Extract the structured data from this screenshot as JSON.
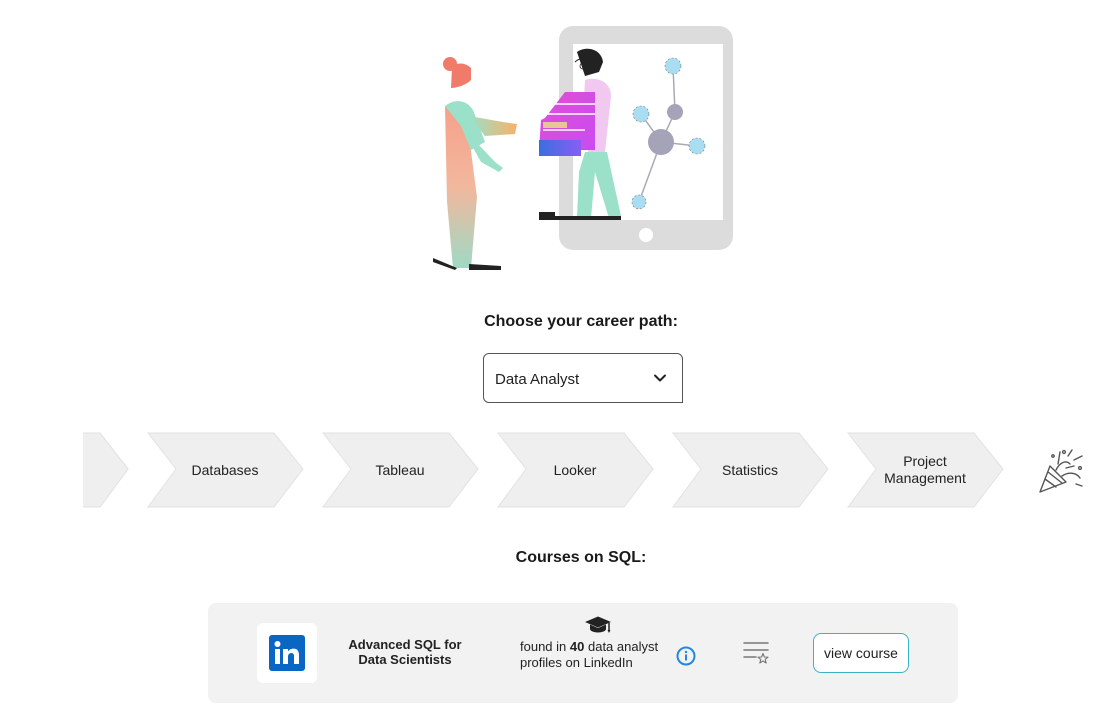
{
  "career": {
    "title": "Choose your career path:",
    "selected": "Data Analyst"
  },
  "steps": [
    "Databases",
    "Tableau",
    "Looker",
    "Statistics",
    "Project Management"
  ],
  "end_icon": "party-popper-icon",
  "courses": {
    "title": "Courses on SQL:",
    "items": [
      {
        "provider": "LinkedIn",
        "provider_logo": "linkedin-logo-icon",
        "name": "Advanced SQL for Data Scientists",
        "found_prefix": "found in",
        "found_count": "40",
        "found_suffix": "data analyst profiles on LinkedIn",
        "button": "view course"
      }
    ]
  },
  "colors": {
    "linkedin_blue": "#0a66c2",
    "button_border": "#3bb3c5",
    "info_blue": "#1e88e5",
    "step_fill": "#efefef",
    "card_bg": "#f2f2f2"
  }
}
